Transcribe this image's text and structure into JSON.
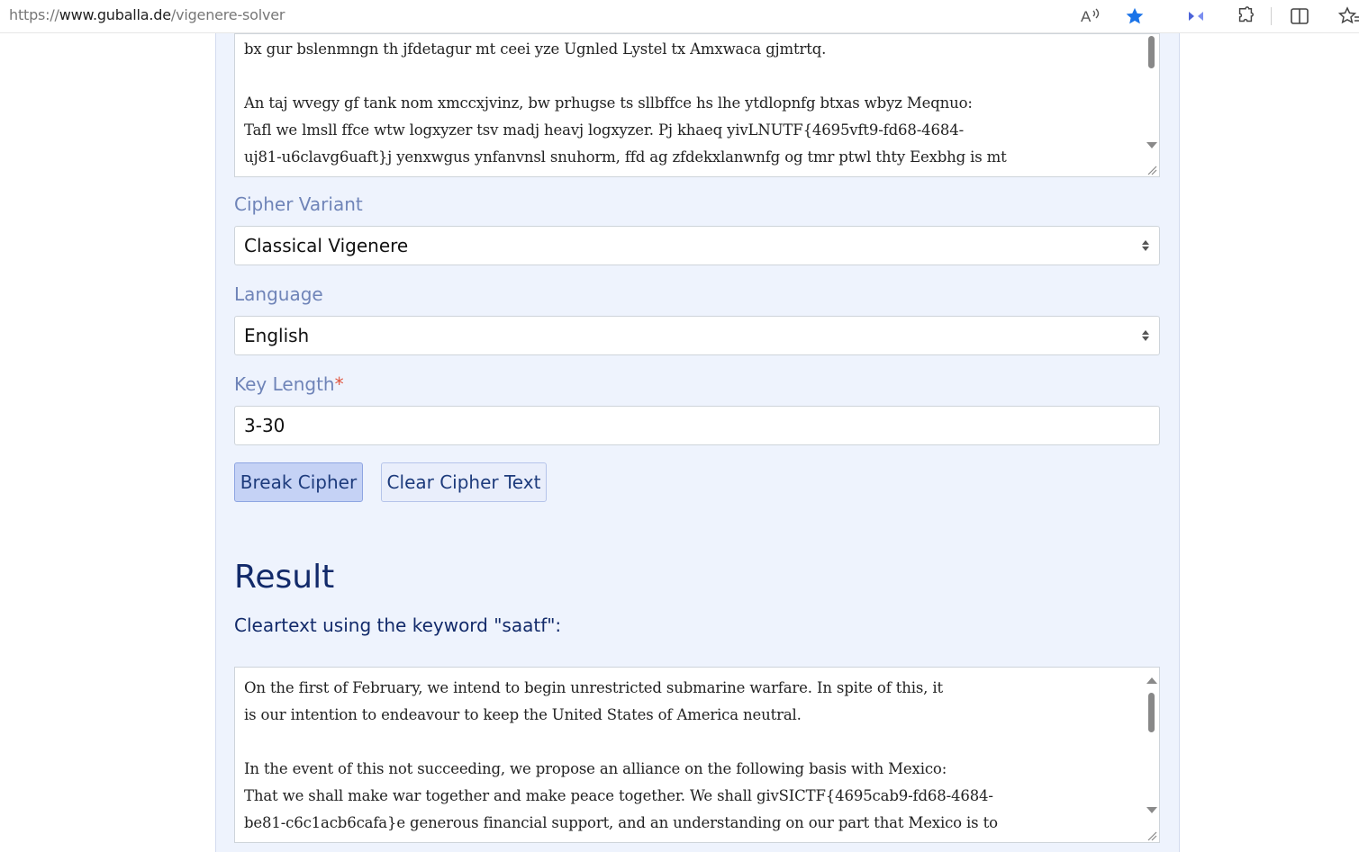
{
  "browser": {
    "url_prefix": "https://",
    "url_host": "www.guballa.de",
    "url_path": "/vigenere-solver"
  },
  "cipher_text": {
    "lines": [
      "bx gur bslenmngn th jfdetagur mt ceei yze Ugnled Lystel tx Amxwaca gjmtrtq.",
      "",
      "An taj wvegy gf tank nom xmccxjvinz, bw prhugse ts sllbffce hs lhe ytdlopnfg btxas wbyz Meqnuo:",
      "Tafl we lmsll ffce wtw logxyzer tsv madj heavj logxyzer. Pj khaeq yivLNUTF{4695vft9-fd68-4684-",
      "uj81-u6clavg6uaft}j yenxwgus ynfanvnsl snuhorm, ffd ag zfdekxlanwnfg og tmr ptwl thty Eexbhg is mt"
    ]
  },
  "form": {
    "cipher_variant_label": "Cipher Variant",
    "cipher_variant_value": "Classical Vigenere",
    "language_label": "Language",
    "language_value": "English",
    "key_length_label": "Key Length",
    "key_length_required": "*",
    "key_length_value": "3-30",
    "break_button": "Break Cipher",
    "clear_button": "Clear Cipher Text"
  },
  "result": {
    "title": "Result",
    "subtitle": "Cleartext using the keyword \"saatf\":",
    "lines": [
      "On the first of February, we intend to begin unrestricted submarine warfare. In spite of this, it",
      "is our intention to endeavour to keep the United States of America neutral.",
      "",
      "In the event of this not succeeding, we propose an alliance on the following basis with Mexico:",
      "That we shall make war together and make peace together. We shall givSICTF{4695cab9-fd68-4684-",
      "be81-c6c1acb6cafa}e generous financial support, and an understanding on our part that Mexico is to"
    ]
  },
  "icons": [
    "read-aloud-icon",
    "favorite-star-icon",
    "extension-icon",
    "puzzle-icon",
    "split-screen-icon",
    "favorites-icon"
  ],
  "colors": {
    "label": "#6f84b8",
    "heading": "#122a6a",
    "panel": "#eef3fd",
    "star": "#1a73e8"
  }
}
